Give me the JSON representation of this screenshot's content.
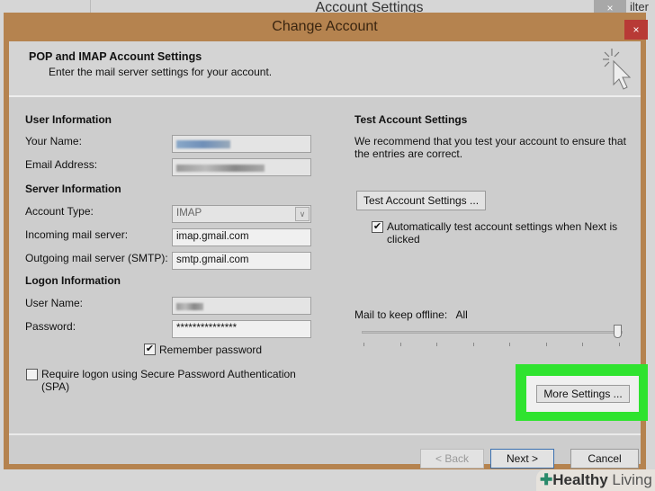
{
  "background": {
    "title": "Account Settings",
    "close": "×",
    "filter": "ilter"
  },
  "dialog": {
    "title": "Change Account",
    "close": "×"
  },
  "header": {
    "title": "POP and IMAP Account Settings",
    "subtitle": "Enter the mail server settings for your account."
  },
  "user_info": {
    "heading": "User Information",
    "name_label": "Your Name:",
    "email_label": "Email Address:"
  },
  "server_info": {
    "heading": "Server Information",
    "account_type_label": "Account Type:",
    "account_type": "IMAP",
    "incoming_label": "Incoming mail server:",
    "incoming": "imap.gmail.com",
    "outgoing_label": "Outgoing mail server (SMTP):",
    "outgoing": "smtp.gmail.com"
  },
  "logon": {
    "heading": "Logon Information",
    "username_label": "User Name:",
    "password_label": "Password:",
    "password": "***************",
    "remember": "Remember password",
    "remember_checked": true,
    "spa": "Require logon using Secure Password Authentication (SPA)",
    "spa_checked": false
  },
  "test": {
    "heading": "Test Account Settings",
    "desc": "We recommend that you test your account to ensure that the entries are correct.",
    "button": "Test Account Settings ...",
    "auto": "Automatically test account settings when Next is clicked",
    "auto_checked": true
  },
  "offline": {
    "label": "Mail to keep offline:",
    "value": "All",
    "slider_fraction": 1.0
  },
  "buttons": {
    "more": "More Settings ...",
    "back": "< Back",
    "next": "Next >",
    "cancel": "Cancel"
  },
  "watermark": {
    "brand1": "Healthy",
    "brand2": " Living"
  },
  "colors": {
    "frame": "#b5834f",
    "highlight": "#2fe32f",
    "close": "#b83a36"
  }
}
